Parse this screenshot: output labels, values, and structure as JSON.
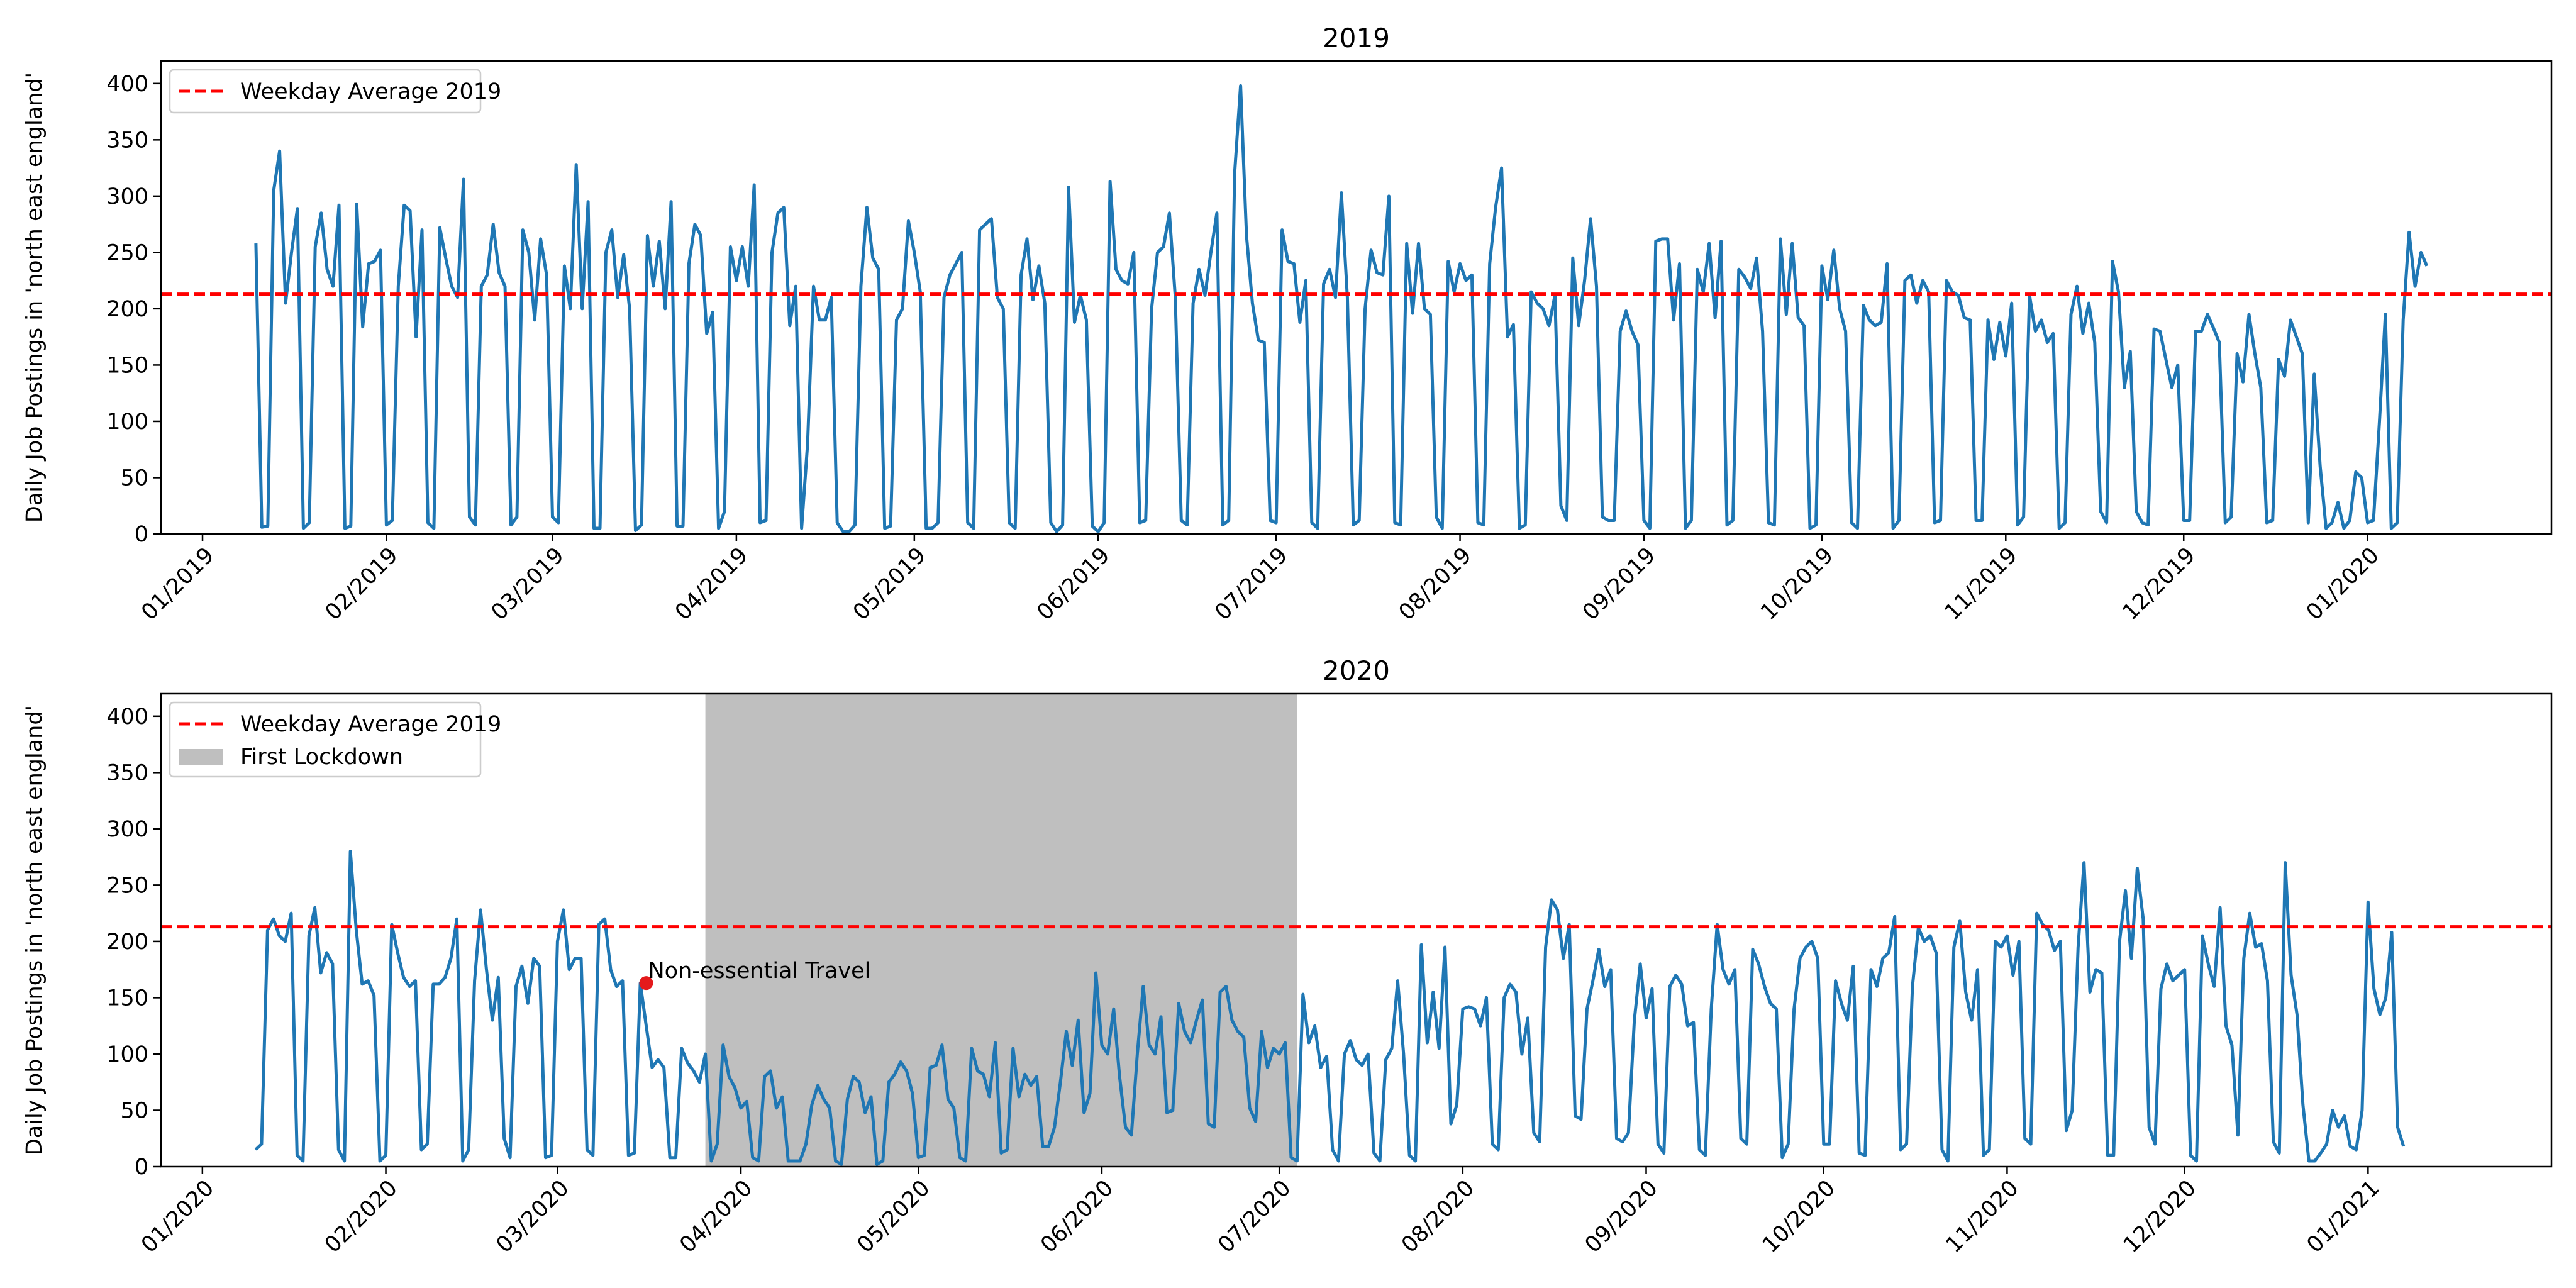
{
  "colors": {
    "series": "#1f77b4",
    "average": "#ff0000",
    "lockdown": "#bfbfbf",
    "annotation_point": "#e41a1c"
  },
  "chart_data": [
    {
      "type": "line",
      "title": "2019",
      "xlabel": "",
      "ylabel": "Daily Job Postings in 'north east england'",
      "x_axis": "date",
      "x_start": "2019-01-10",
      "x_step_days": 1,
      "xlim": [
        "2018-12-25",
        "2020-02-01"
      ],
      "ylim": [
        0,
        420
      ],
      "yticks": [
        0,
        50,
        100,
        150,
        200,
        250,
        300,
        350,
        400
      ],
      "xticks": [
        {
          "date": "2019-01-01",
          "label": "01/2019"
        },
        {
          "date": "2019-02-01",
          "label": "02/2019"
        },
        {
          "date": "2019-03-01",
          "label": "03/2019"
        },
        {
          "date": "2019-04-01",
          "label": "04/2019"
        },
        {
          "date": "2019-05-01",
          "label": "05/2019"
        },
        {
          "date": "2019-06-01",
          "label": "06/2019"
        },
        {
          "date": "2019-07-01",
          "label": "07/2019"
        },
        {
          "date": "2019-08-01",
          "label": "08/2019"
        },
        {
          "date": "2019-09-01",
          "label": "09/2019"
        },
        {
          "date": "2019-10-01",
          "label": "10/2019"
        },
        {
          "date": "2019-11-01",
          "label": "11/2019"
        },
        {
          "date": "2019-12-01",
          "label": "12/2019"
        },
        {
          "date": "2020-01-01",
          "label": "01/2020"
        }
      ],
      "reference_line": {
        "label": "Weekday Average 2019",
        "value": 213
      },
      "legend_location": "upper-left",
      "grid": false,
      "series": [
        {
          "values": [
            258,
            6,
            7,
            305,
            340,
            205,
            250,
            289,
            5,
            10,
            255,
            285,
            235,
            220,
            292,
            5,
            7,
            293,
            184,
            240,
            242,
            252,
            8,
            12,
            220,
            292,
            287,
            175,
            270,
            10,
            5,
            272,
            245,
            220,
            210,
            315,
            15,
            8,
            220,
            230,
            275,
            232,
            220,
            8,
            15,
            270,
            250,
            190,
            262,
            230,
            15,
            10,
            238,
            200,
            328,
            200,
            295,
            5,
            5,
            250,
            270,
            210,
            248,
            200,
            3,
            8,
            265,
            220,
            260,
            200,
            295,
            7,
            7,
            240,
            275,
            265,
            178,
            197,
            5,
            20,
            255,
            225,
            255,
            220,
            310,
            10,
            12,
            250,
            285,
            290,
            185,
            220,
            5,
            80,
            220,
            190,
            190,
            210,
            10,
            2,
            2,
            8,
            220,
            290,
            245,
            235,
            5,
            7,
            190,
            200,
            278,
            250,
            215,
            5,
            5,
            10,
            210,
            230,
            240,
            250,
            10,
            5,
            270,
            275,
            280,
            210,
            200,
            10,
            5,
            230,
            262,
            208,
            238,
            205,
            10,
            2,
            8,
            308,
            188,
            212,
            190,
            7,
            2,
            10,
            313,
            235,
            225,
            222,
            250,
            10,
            12,
            200,
            250,
            255,
            285,
            210,
            12,
            8,
            205,
            235,
            212,
            250,
            285,
            8,
            12,
            320,
            398,
            265,
            205,
            172,
            170,
            12,
            10,
            270,
            242,
            240,
            188,
            225,
            10,
            5,
            222,
            235,
            210,
            303,
            210,
            8,
            12,
            200,
            252,
            232,
            230,
            300,
            10,
            8,
            258,
            196,
            258,
            200,
            195,
            15,
            5,
            242,
            215,
            240,
            225,
            230,
            10,
            8,
            240,
            290,
            325,
            175,
            186,
            5,
            8,
            215,
            205,
            200,
            185,
            212,
            25,
            12,
            245,
            185,
            225,
            280,
            220,
            15,
            12,
            12,
            180,
            198,
            180,
            168,
            12,
            5,
            260,
            262,
            262,
            190,
            240,
            5,
            12,
            235,
            215,
            258,
            192,
            260,
            8,
            12,
            235,
            228,
            218,
            245,
            180,
            10,
            8,
            262,
            195,
            258,
            192,
            185,
            5,
            8,
            238,
            208,
            252,
            200,
            180,
            10,
            5,
            203,
            190,
            185,
            188,
            240,
            5,
            12,
            225,
            230,
            205,
            225,
            215,
            10,
            12,
            225,
            215,
            212,
            192,
            190,
            12,
            12,
            190,
            155,
            188,
            158,
            205,
            8,
            15,
            212,
            180,
            190,
            170,
            178,
            5,
            10,
            195,
            220,
            178,
            205,
            170,
            20,
            10,
            242,
            215,
            130,
            162,
            20,
            10,
            8,
            182,
            180,
            155,
            130,
            150,
            12,
            12,
            180,
            180,
            195,
            183,
            170,
            10,
            15,
            160,
            135,
            195,
            160,
            130,
            10,
            12,
            155,
            140,
            190,
            175,
            160,
            10,
            142,
            60,
            5,
            10,
            28,
            5,
            12,
            55,
            50,
            10,
            12,
            100,
            195,
            5,
            10,
            190,
            268,
            220,
            250,
            238
          ]
        }
      ]
    },
    {
      "type": "line",
      "title": "2020",
      "xlabel": "",
      "ylabel": "Daily Job Postings in 'north east england'",
      "x_axis": "date",
      "x_start": "2020-01-10",
      "x_step_days": 1,
      "xlim": [
        "2019-12-25",
        "2021-02-01"
      ],
      "ylim": [
        0,
        420
      ],
      "yticks": [
        0,
        50,
        100,
        150,
        200,
        250,
        300,
        350,
        400
      ],
      "xticks": [
        {
          "date": "2020-01-01",
          "label": "01/2020"
        },
        {
          "date": "2020-02-01",
          "label": "02/2020"
        },
        {
          "date": "2020-03-01",
          "label": "03/2020"
        },
        {
          "date": "2020-04-01",
          "label": "04/2020"
        },
        {
          "date": "2020-05-01",
          "label": "05/2020"
        },
        {
          "date": "2020-06-01",
          "label": "06/2020"
        },
        {
          "date": "2020-07-01",
          "label": "07/2020"
        },
        {
          "date": "2020-08-01",
          "label": "08/2020"
        },
        {
          "date": "2020-09-01",
          "label": "09/2020"
        },
        {
          "date": "2020-10-01",
          "label": "10/2020"
        },
        {
          "date": "2020-11-01",
          "label": "11/2020"
        },
        {
          "date": "2020-12-01",
          "label": "12/2020"
        },
        {
          "date": "2021-01-01",
          "label": "01/2021"
        }
      ],
      "reference_line": {
        "label": "Weekday Average 2019",
        "value": 213
      },
      "shaded_region": {
        "label": "First Lockdown",
        "start": "2020-03-26",
        "end": "2020-07-04"
      },
      "annotation": {
        "text": "Non-essential Travel",
        "date": "2020-03-16",
        "value": 163
      },
      "legend_location": "upper-left",
      "grid": false,
      "series": [
        {
          "values": [
            15,
            20,
            210,
            220,
            205,
            200,
            225,
            10,
            5,
            205,
            230,
            172,
            190,
            180,
            15,
            5,
            280,
            210,
            162,
            165,
            152,
            5,
            10,
            215,
            190,
            168,
            160,
            165,
            15,
            20,
            162,
            162,
            168,
            185,
            220,
            5,
            15,
            165,
            228,
            175,
            130,
            168,
            25,
            8,
            160,
            178,
            145,
            185,
            178,
            8,
            10,
            200,
            228,
            175,
            185,
            185,
            15,
            10,
            215,
            220,
            175,
            160,
            165,
            10,
            12,
            163,
            125,
            88,
            95,
            88,
            8,
            8,
            105,
            92,
            85,
            75,
            100,
            5,
            20,
            108,
            80,
            70,
            52,
            58,
            8,
            5,
            80,
            85,
            52,
            62,
            5,
            5,
            5,
            20,
            55,
            72,
            60,
            52,
            5,
            2,
            60,
            80,
            75,
            48,
            62,
            2,
            5,
            75,
            82,
            93,
            85,
            65,
            8,
            10,
            88,
            90,
            108,
            60,
            52,
            8,
            5,
            105,
            85,
            82,
            62,
            110,
            12,
            15,
            105,
            62,
            82,
            72,
            80,
            18,
            18,
            35,
            75,
            120,
            90,
            130,
            48,
            65,
            172,
            108,
            100,
            140,
            80,
            35,
            28,
            100,
            160,
            108,
            100,
            133,
            48,
            50,
            145,
            120,
            110,
            130,
            148,
            38,
            35,
            155,
            160,
            130,
            120,
            115,
            52,
            40,
            120,
            88,
            105,
            100,
            110,
            8,
            5,
            153,
            110,
            125,
            88,
            98,
            15,
            5,
            100,
            112,
            95,
            90,
            100,
            12,
            5,
            95,
            105,
            165,
            100,
            10,
            5,
            197,
            110,
            155,
            105,
            195,
            38,
            55,
            140,
            142,
            140,
            125,
            150,
            20,
            15,
            150,
            162,
            155,
            100,
            132,
            30,
            22,
            195,
            237,
            228,
            185,
            215,
            45,
            42,
            140,
            165,
            193,
            160,
            175,
            25,
            22,
            30,
            130,
            180,
            132,
            158,
            20,
            12,
            160,
            170,
            162,
            125,
            128,
            15,
            10,
            140,
            215,
            175,
            162,
            175,
            25,
            20,
            193,
            180,
            160,
            145,
            140,
            8,
            20,
            140,
            185,
            195,
            200,
            185,
            20,
            20,
            165,
            145,
            130,
            178,
            12,
            10,
            175,
            160,
            185,
            190,
            222,
            15,
            20,
            160,
            212,
            200,
            205,
            190,
            15,
            5,
            195,
            218,
            155,
            130,
            175,
            10,
            15,
            200,
            195,
            205,
            170,
            200,
            25,
            20,
            225,
            215,
            210,
            192,
            200,
            32,
            50,
            195,
            270,
            155,
            175,
            172,
            10,
            10,
            200,
            245,
            185,
            265,
            220,
            35,
            20,
            158,
            180,
            165,
            170,
            175,
            10,
            5,
            205,
            180,
            160,
            230,
            125,
            108,
            28,
            185,
            225,
            195,
            198,
            165,
            22,
            12,
            270,
            170,
            135,
            55,
            5,
            5,
            12,
            20,
            50,
            35,
            45,
            18,
            15,
            50,
            235,
            158,
            135,
            150,
            208,
            35,
            18
          ]
        }
      ]
    }
  ]
}
